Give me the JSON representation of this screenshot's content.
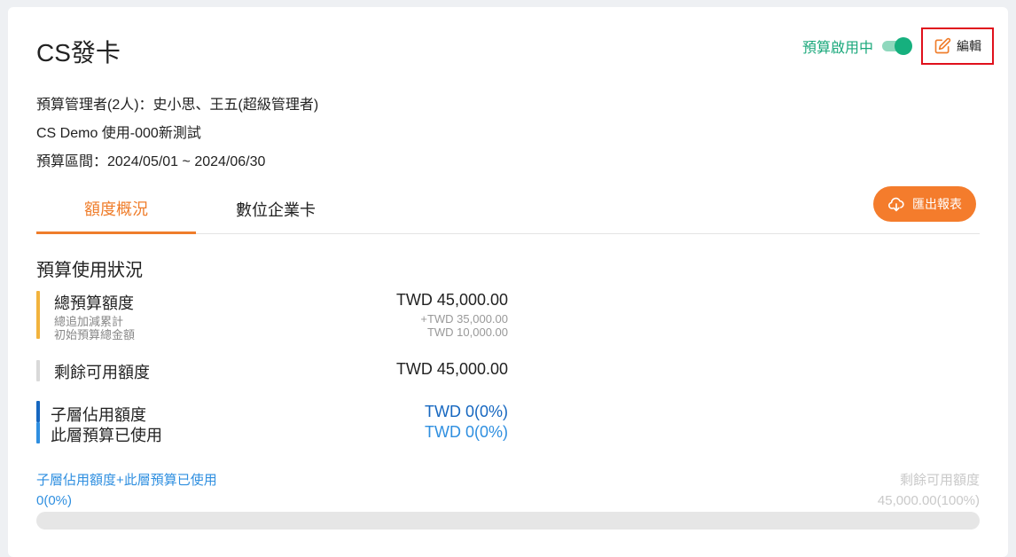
{
  "header": {
    "title": "CS發卡",
    "toggle_label": "預算啟用中",
    "toggle_on": true,
    "edit_label": "編輯"
  },
  "info": {
    "managers": "預算管理者(2人)：史小思、王五(超級管理者)",
    "project": "CS Demo 使用-000新測試",
    "period": "預算區間：2024/05/01 ~ 2024/06/30"
  },
  "tabs": [
    {
      "label": "額度概況",
      "active": true
    },
    {
      "label": "數位企業卡",
      "active": false
    }
  ],
  "export_label": "匯出報表",
  "section_title": "預算使用狀況",
  "budget": {
    "total": {
      "label": "總預算額度",
      "value": "TWD 45,000.00",
      "sub1_label": "總追加減累計",
      "sub1_value": "+TWD 35,000.00",
      "sub2_label": "初始預算總金額",
      "sub2_value": "TWD 10,000.00"
    },
    "remaining": {
      "label": "剩餘可用額度",
      "value": "TWD 45,000.00"
    },
    "child": {
      "label": "子層佔用額度",
      "value": "TWD 0(0%)"
    },
    "used": {
      "label": "此層預算已使用",
      "value": "TWD 0(0%)"
    }
  },
  "progress": {
    "left_label": "子層佔用額度+此層預算已使用",
    "left_value": "0(0%)",
    "right_label": "剩餘可用額度",
    "right_value": "45,000.00(100%)",
    "used_fraction": 0
  },
  "colors": {
    "accent": "#ef7d2b",
    "toggle_green": "#16b07e",
    "total_bar": "#f2b33d",
    "remaining_bar": "#d9d9d9",
    "child_bar": "#1667c0",
    "used_bar": "#2f8fe0"
  }
}
